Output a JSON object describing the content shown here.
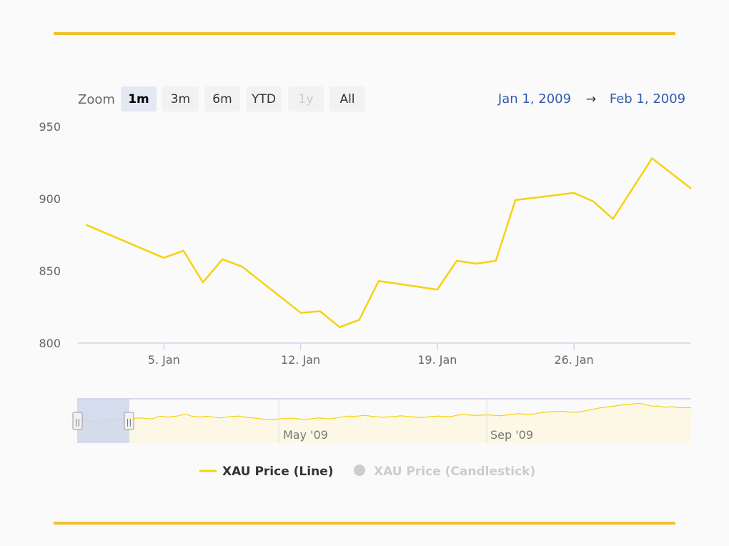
{
  "range_selector": {
    "zoom_label": "Zoom",
    "buttons": [
      {
        "label": "1m",
        "state": "active"
      },
      {
        "label": "3m",
        "state": "normal"
      },
      {
        "label": "6m",
        "state": "normal"
      },
      {
        "label": "YTD",
        "state": "normal"
      },
      {
        "label": "1y",
        "state": "disabled"
      },
      {
        "label": "All",
        "state": "normal"
      }
    ],
    "from_date": "Jan 1, 2009",
    "arrow": "→",
    "to_date": "Feb 1, 2009"
  },
  "chart_data": {
    "type": "line",
    "ylim": [
      800,
      950
    ],
    "y_ticks": [
      800,
      850,
      900,
      950
    ],
    "xlim": [
      "2009-01-01",
      "2009-02-01"
    ],
    "x_ticks": [
      {
        "label": "5. Jan",
        "date": "2009-01-05"
      },
      {
        "label": "12. Jan",
        "date": "2009-01-12"
      },
      {
        "label": "19. Jan",
        "date": "2009-01-19"
      },
      {
        "label": "26. Jan",
        "date": "2009-01-26"
      }
    ],
    "grid": false,
    "legend_position": "bottom-center",
    "series": [
      {
        "name": "XAU Price (Line)",
        "color": "#f5d210",
        "visible": true,
        "points": [
          {
            "x": "2009-01-01",
            "y": 882
          },
          {
            "x": "2009-01-05",
            "y": 859
          },
          {
            "x": "2009-01-06",
            "y": 864
          },
          {
            "x": "2009-01-07",
            "y": 842
          },
          {
            "x": "2009-01-08",
            "y": 858
          },
          {
            "x": "2009-01-09",
            "y": 853
          },
          {
            "x": "2009-01-12",
            "y": 821
          },
          {
            "x": "2009-01-13",
            "y": 822
          },
          {
            "x": "2009-01-14",
            "y": 811
          },
          {
            "x": "2009-01-15",
            "y": 816
          },
          {
            "x": "2009-01-16",
            "y": 843
          },
          {
            "x": "2009-01-19",
            "y": 837
          },
          {
            "x": "2009-01-20",
            "y": 857
          },
          {
            "x": "2009-01-21",
            "y": 855
          },
          {
            "x": "2009-01-22",
            "y": 857
          },
          {
            "x": "2009-01-23",
            "y": 899
          },
          {
            "x": "2009-01-26",
            "y": 904
          },
          {
            "x": "2009-01-27",
            "y": 898
          },
          {
            "x": "2009-01-28",
            "y": 886
          },
          {
            "x": "2009-01-29",
            "y": 907
          },
          {
            "x": "2009-01-30",
            "y": 928
          },
          {
            "x": "2009-02-01",
            "y": 907
          }
        ]
      },
      {
        "name": "XAU Price (Candlestick)",
        "color": "#cccccc",
        "visible": false
      }
    ]
  },
  "navigator": {
    "tick_labels": [
      "May '09",
      "Sep '09"
    ],
    "series_color": "#f5d210",
    "fill_color": "#fdf8e6",
    "mask_color": "#ccd6eb",
    "handle_glyph": "||",
    "values": [
      858,
      855,
      853,
      851,
      850,
      848,
      852,
      856,
      858,
      857,
      856,
      858,
      860,
      862,
      861,
      859,
      860,
      866,
      868,
      864,
      867,
      868,
      872,
      873,
      868,
      866,
      865,
      867,
      866,
      864,
      862,
      864,
      866,
      867,
      868,
      865,
      863,
      862,
      860,
      858,
      857,
      856,
      858,
      860,
      859,
      861,
      860,
      858,
      857,
      859,
      861,
      862,
      860,
      859,
      861,
      864,
      866,
      868,
      867,
      868,
      870,
      869,
      867,
      866,
      864,
      865,
      866,
      867,
      869,
      867,
      866,
      865,
      863,
      864,
      866,
      867,
      868,
      867,
      866,
      868,
      871,
      873,
      872,
      871,
      870,
      871,
      872,
      871,
      870,
      869,
      871,
      873,
      875,
      876,
      874,
      873,
      875,
      878,
      880,
      881,
      883,
      882,
      884,
      882,
      880,
      881,
      883,
      886,
      889,
      892,
      895,
      897,
      899,
      901,
      903,
      905,
      906,
      908,
      910,
      907,
      903,
      900,
      901,
      898,
      897,
      899,
      896,
      895,
      896,
      895
    ]
  }
}
